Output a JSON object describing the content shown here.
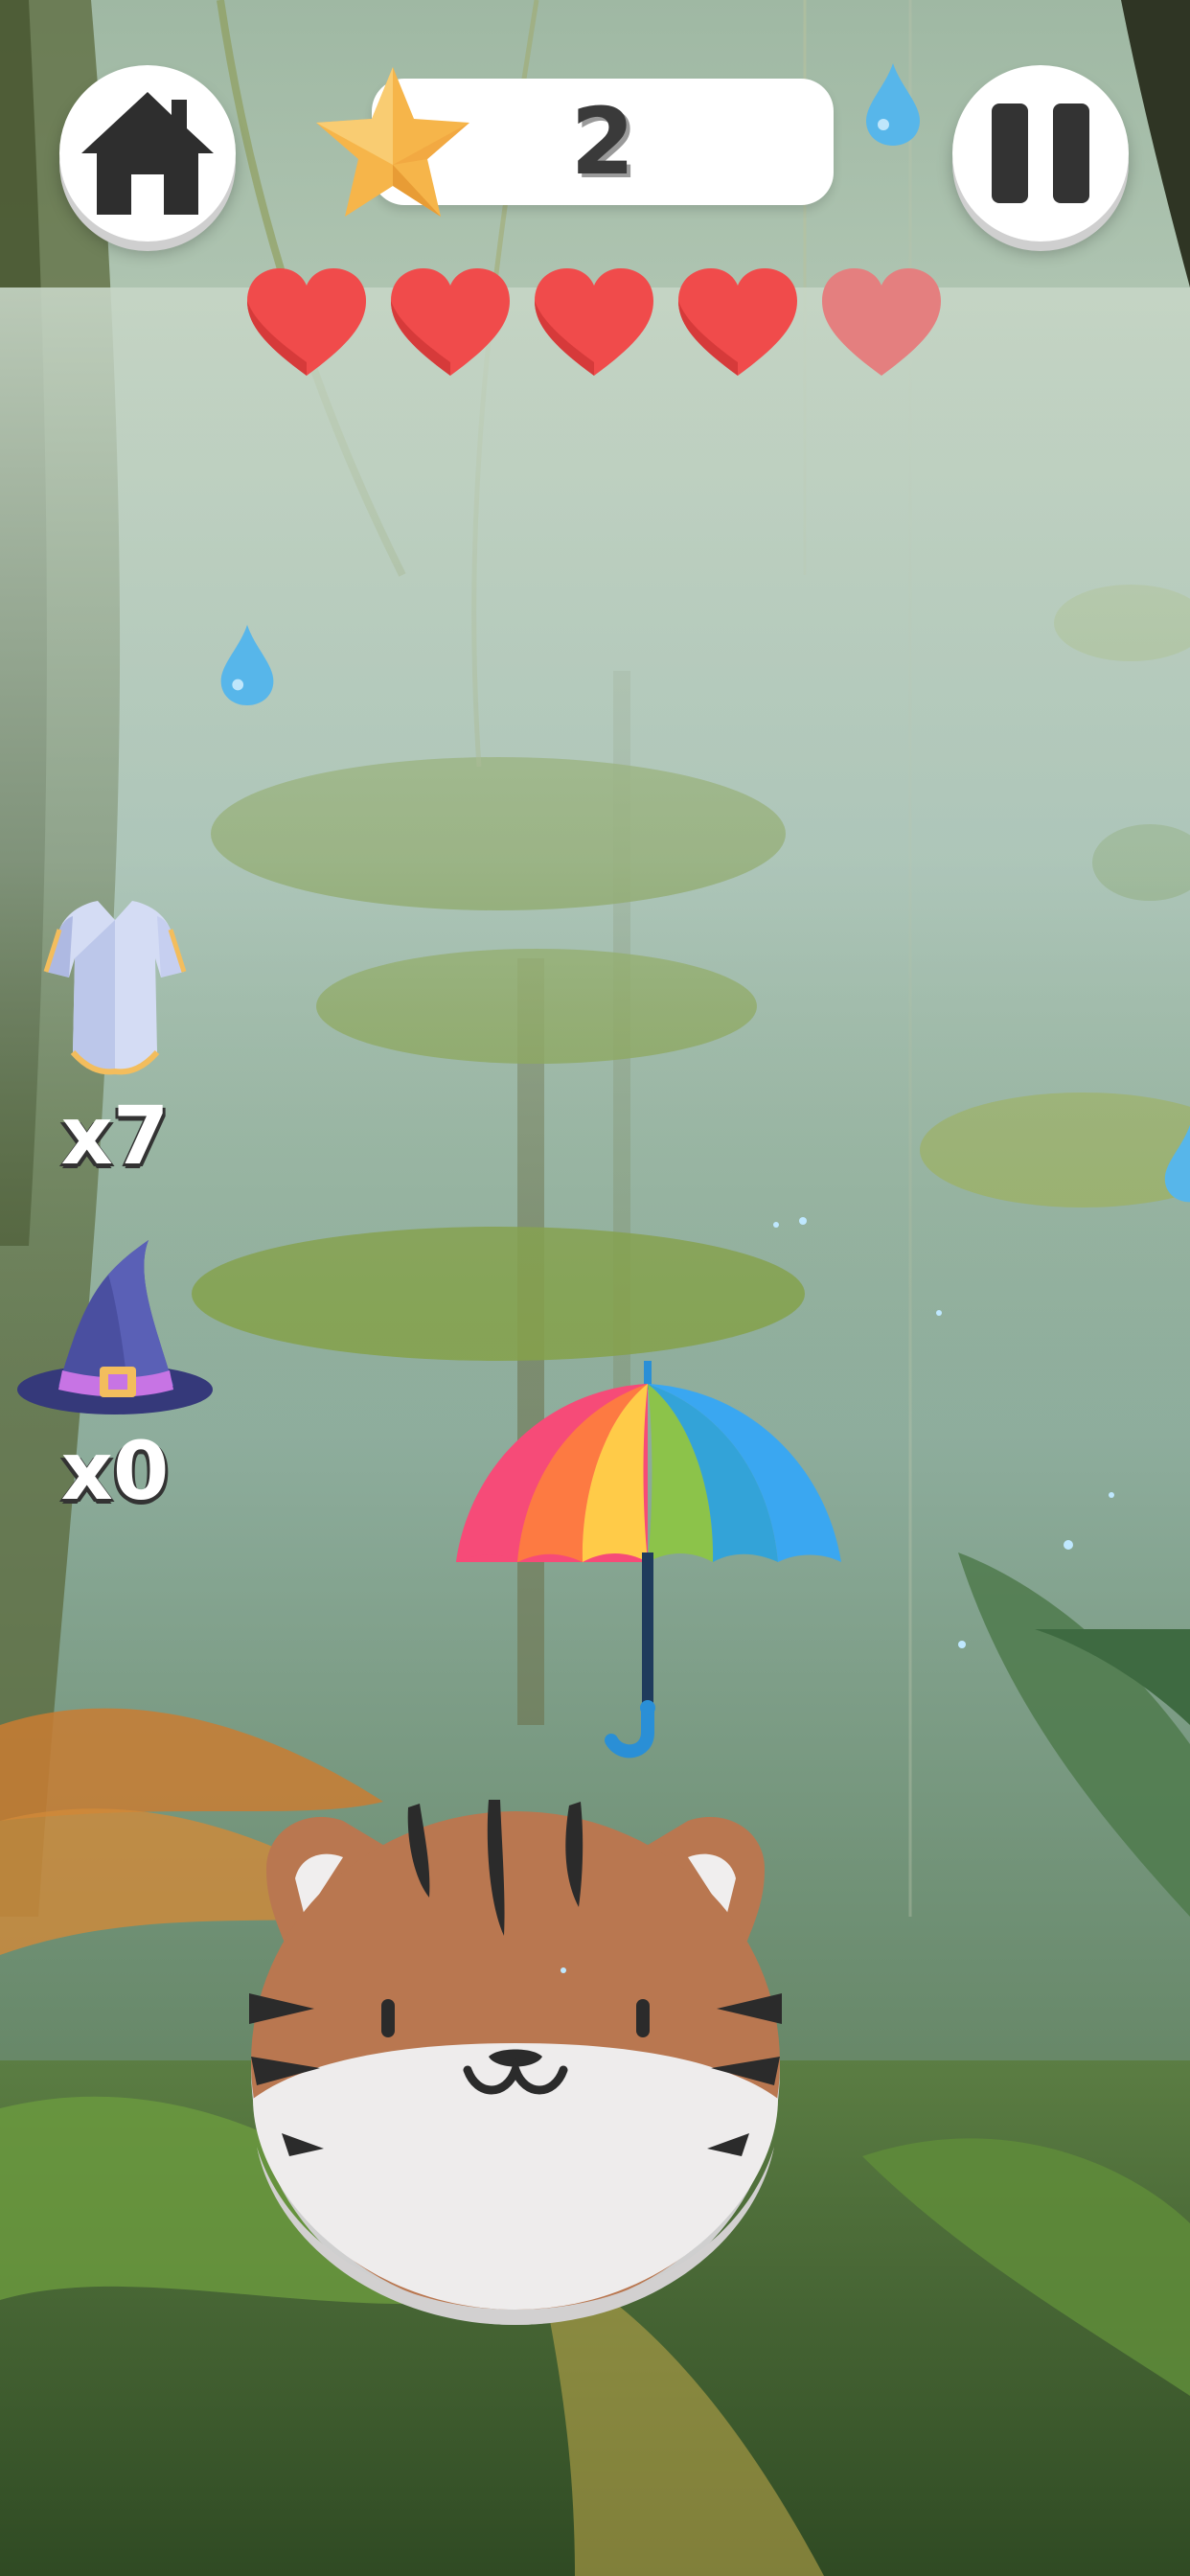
{
  "hud": {
    "score": "2",
    "hearts": [
      {
        "state": "full"
      },
      {
        "state": "full"
      },
      {
        "state": "full"
      },
      {
        "state": "full"
      },
      {
        "state": "faded"
      }
    ],
    "icons": {
      "home": "home-icon",
      "pause": "pause-icon",
      "star": "star-icon",
      "raindrop": "raindrop-icon"
    }
  },
  "powerups": [
    {
      "name": "armor",
      "icon": "armor-icon",
      "count": "x7"
    },
    {
      "name": "wizard-hat",
      "icon": "wizard-hat-icon",
      "count": "x0"
    }
  ],
  "scene": {
    "player": "tiger",
    "held_item": "rainbow-umbrella",
    "background": "rainy jungle"
  },
  "colors": {
    "heart_full": "#f04b4b",
    "heart_faded": "#e47f7f",
    "star": "#f6b54a",
    "tiger_orange": "#b97750",
    "raindrop": "#57b6ea"
  }
}
